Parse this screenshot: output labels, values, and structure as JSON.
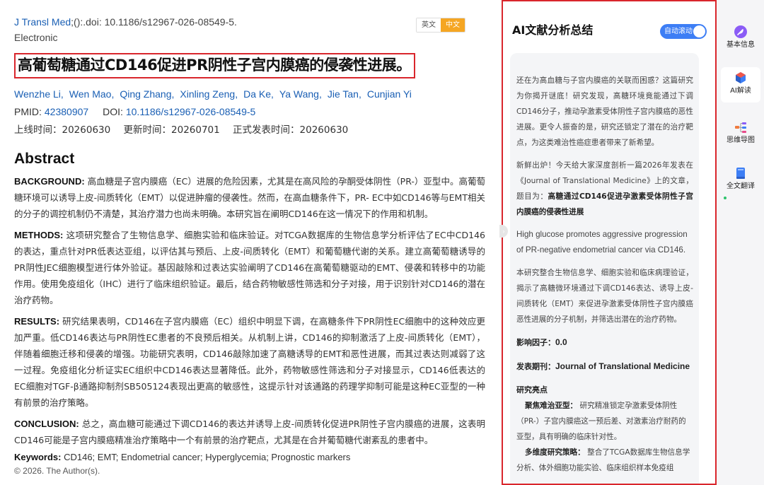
{
  "article": {
    "citation_journal": "J Transl Med",
    "citation_rest": ";():.doi: 10.1186/s12967-026-08549-5.",
    "citation_type": "Electronic",
    "lang_en": "英文",
    "lang_cn": "中文",
    "title": "高葡萄糖通过CD146促进PR阴性子宫内膜癌的侵袭性进展。",
    "authors": [
      "Wenzhe Li,",
      "Wen Mao,",
      "Qing Zhang,",
      "Xinling Zeng,",
      "Da Ke,",
      "Ya Wang,",
      "Jie Tan,",
      "Cunjian Yi"
    ],
    "pmid_label": "PMID:",
    "pmid": "42380907",
    "doi_label": "DOI:",
    "doi": "10.1186/s12967-026-08549-5",
    "online_date": "上线时间：20260630",
    "update_date": "更新时间：20260701",
    "publish_date": "正式发表时间：20260630",
    "abstract_heading": "Abstract",
    "background_label": "BACKGROUND:",
    "background_text": " 高血糖是子宫内膜癌（EC）进展的危险因素，尤其是在高风险的孕酮受体阴性（PR-）亚型中。高葡萄糖环境可以诱导上皮-间质转化（EMT）以促进肿瘤的侵袭性。然而，在高血糖条件下，PR- EC中如CD146等与EMT相关的分子的调控机制仍不清楚，其治疗潜力也尚未明确。本研究旨在阐明CD146在这一情况下的作用和机制。",
    "methods_label": "METHODS:",
    "methods_text": " 这项研究整合了生物信息学、细胞实验和临床验证。对TCGA数据库的生物信息学分析评估了EC中CD146的表达，重点针对PR低表达亚组，以评估其与预后、上皮-间质转化（EMT）和葡萄糖代谢的关系。建立高葡萄糖诱导的PR阴性JEC细胞模型进行体外验证。基因敲除和过表达实验阐明了CD146在高葡萄糖驱动的EMT、侵袭和转移中的功能作用。使用免疫组化（IHC）进行了临床组织验证。最后，结合药物敏感性筛选和分子对接，用于识别针对CD146的潜在治疗药物。",
    "results_label": "RESULTS:",
    "results_text": " 研究结果表明，CD146在子宫内膜癌（EC）组织中明显下调，在高糖条件下PR阴性EC细胞中的这种效应更加严重。低CD146表达与PR阴性EC患者的不良预后相关。从机制上讲，CD146的抑制激活了上皮-间质转化（EMT），伴随着细胞迁移和侵袭的增强。功能研究表明，CD146敲除加速了高糖诱导的EMT和恶性进展，而其过表达则减弱了这一过程。免疫组化分析证实EC组织中CD146表达显著降低。此外，药物敏感性筛选和分子对接显示，CD146低表达的EC细胞对TGF-β通路抑制剂SB505124表现出更高的敏感性，这提示针对该通路的药理学抑制可能是这种EC亚型的一种有前景的治疗策略。",
    "conclusion_label": "CONCLUSION:",
    "conclusion_text": " 总之，高血糖可能通过下调CD146的表达并诱导上皮-间质转化促进PR阴性子宫内膜癌的进展，这表明CD146可能是子宫内膜癌精准治疗策略中一个有前景的治疗靶点，尤其是在合并葡萄糖代谢紊乱的患者中。",
    "keywords_label": "Keywords:",
    "keywords_text": " CD146; EMT; Endometrial cancer; Hyperglycemia; Prognostic markers",
    "copyright": "© 2026. The Author(s)."
  },
  "ai_panel": {
    "title": "AI文献分析总结",
    "auto_scroll_label": "自动滚动",
    "auto_scroll_on": true,
    "para1": "还在为高血糖与子宫内膜癌的关联而困惑？这篇研究为你揭开谜底！研究发现，高糖环境竟能通过下调CD146分子，推动孕激素受体阴性子宫内膜癌的恶性进展。更令人振奋的是，研究还锁定了潜在的治疗靶点，为这类难治性癌症患者带来了新希望。",
    "para2_prefix": "新鲜出炉！今天给大家深度剖析一篇2026年发表在《Journal of Translational Medicine》上的文章，题目为：",
    "para2_title": "高糖通过CD146促进孕激素受体阴性子宫内膜癌的侵袭性进展",
    "para_en": "High glucose promotes aggressive progression of PR-negative endometrial cancer via CD146.",
    "para3": "本研究整合生物信息学、细胞实验和临床病理验证，揭示了高糖微环境通过下调CD146表达、诱导上皮-间质转化（EMT）来促进孕激素受体阴性子宫内膜癌恶性进展的分子机制，并筛选出潜在的治疗药物。",
    "impact_label": "影响因子：",
    "impact_value": "0.0",
    "journal_label": "发表期刊：",
    "journal_value": "Journal of Translational Medicine",
    "highlights_heading": "研究亮点",
    "point1_label": "聚焦难治亚型：",
    "point1_text": " 研究精准锁定孕激素受体阴性（PR-）子宫内膜癌这一预后差、对激素治疗耐药的亚型，具有明确的临床针对性。",
    "point2_label": "多维度研究策略：",
    "point2_text": " 整合了TCGA数据库生物信息学分析、体外细胞功能实验、临床组织样本免疫组"
  },
  "toolbar": {
    "basic_info": "基本信息",
    "ai_read": "AI解读",
    "mind_map": "思维导图",
    "full_translate": "全文翻译"
  },
  "colors": {
    "accent_blue": "#3d7ef5",
    "link_blue": "#1a5fb4",
    "highlight_red": "#d9262c",
    "lang_orange": "#f5a623"
  }
}
